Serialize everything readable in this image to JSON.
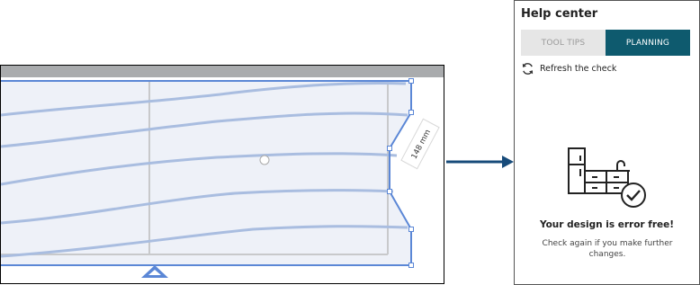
{
  "canvas": {
    "dimension_label": "148 mm"
  },
  "help_center": {
    "title": "Help center",
    "tabs": [
      {
        "label": "TOOL TIPS",
        "active": false
      },
      {
        "label": "PLANNING",
        "active": true
      }
    ],
    "refresh_label": "Refresh the check",
    "status_title": "Your design is error free!",
    "status_subtitle": "Check again if you make further changes.",
    "accent_color": "#0e5a6e"
  }
}
